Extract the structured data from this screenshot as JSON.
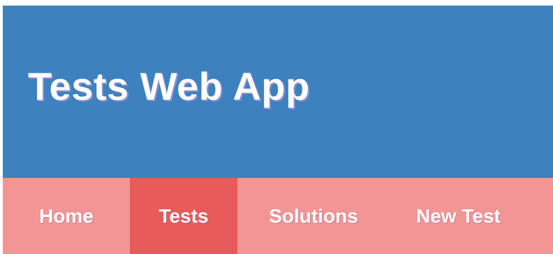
{
  "header": {
    "title": "Tests Web App"
  },
  "nav": {
    "items": [
      {
        "label": "Home"
      },
      {
        "label": "Tests"
      },
      {
        "label": "Solutions"
      },
      {
        "label": "New Test"
      }
    ],
    "active_item": "Tests"
  },
  "colors": {
    "header_background": "#3d82bf",
    "nav_background": "#f29594",
    "nav_active_background": "#e85b5b",
    "text": "#ffffff"
  }
}
